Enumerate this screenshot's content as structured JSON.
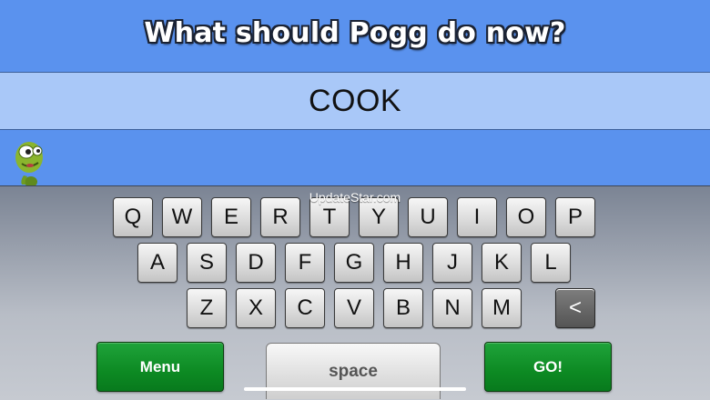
{
  "title": "What should Pogg do now?",
  "current_word": "COOK",
  "character": "pogg-alien",
  "watermark": "UpdateStar.com",
  "keyboard": {
    "row1": [
      "Q",
      "W",
      "E",
      "R",
      "T",
      "Y",
      "U",
      "I",
      "O",
      "P"
    ],
    "row2": [
      "A",
      "S",
      "D",
      "F",
      "G",
      "H",
      "J",
      "K",
      "L"
    ],
    "row3": [
      "Z",
      "X",
      "C",
      "V",
      "B",
      "N",
      "M"
    ],
    "backspace_label": "<",
    "space_label": "space",
    "menu_label": "Menu",
    "go_label": "GO!"
  },
  "colors": {
    "sky_blue": "#5a92ee",
    "word_bar": "#a9c8f8",
    "go_green": "#0d8a23"
  }
}
